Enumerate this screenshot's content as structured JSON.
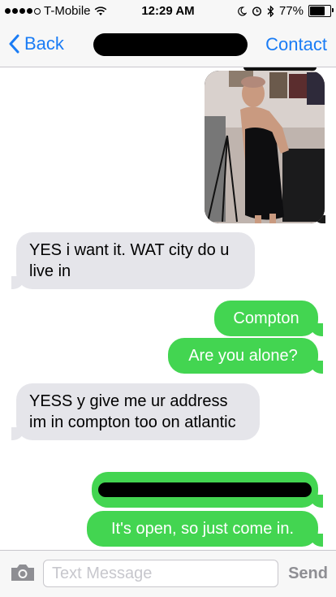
{
  "status_bar": {
    "carrier": "T-Mobile",
    "time": "12:29 AM",
    "battery": "77%",
    "battery_level": 0.77,
    "signal_bars": 4,
    "icons": [
      "wifi-icon",
      "moon-icon",
      "alarm-icon",
      "bluetooth-icon",
      "battery-icon"
    ]
  },
  "nav": {
    "back_label": "Back",
    "contact_label": "Contact"
  },
  "messages": [
    {
      "direction": "outgoing",
      "type": "photo"
    },
    {
      "direction": "incoming",
      "text": "YES i want it. WAT city do u live in"
    },
    {
      "direction": "outgoing",
      "text": "Compton"
    },
    {
      "direction": "outgoing",
      "text": "Are you alone?"
    },
    {
      "direction": "incoming",
      "text": "YESS y give me ur address im in compton too on atlantic"
    },
    {
      "direction": "outgoing",
      "type": "redacted"
    },
    {
      "direction": "outgoing",
      "text": "It's open, so just come in."
    }
  ],
  "input": {
    "placeholder": "Text Message",
    "value": "",
    "send_label": "Send"
  },
  "colors": {
    "ios_blue": "#1a7cf5",
    "outgoing_green": "#43d551",
    "incoming_gray": "#e5e5ea",
    "bar_background": "#f7f7f7"
  }
}
